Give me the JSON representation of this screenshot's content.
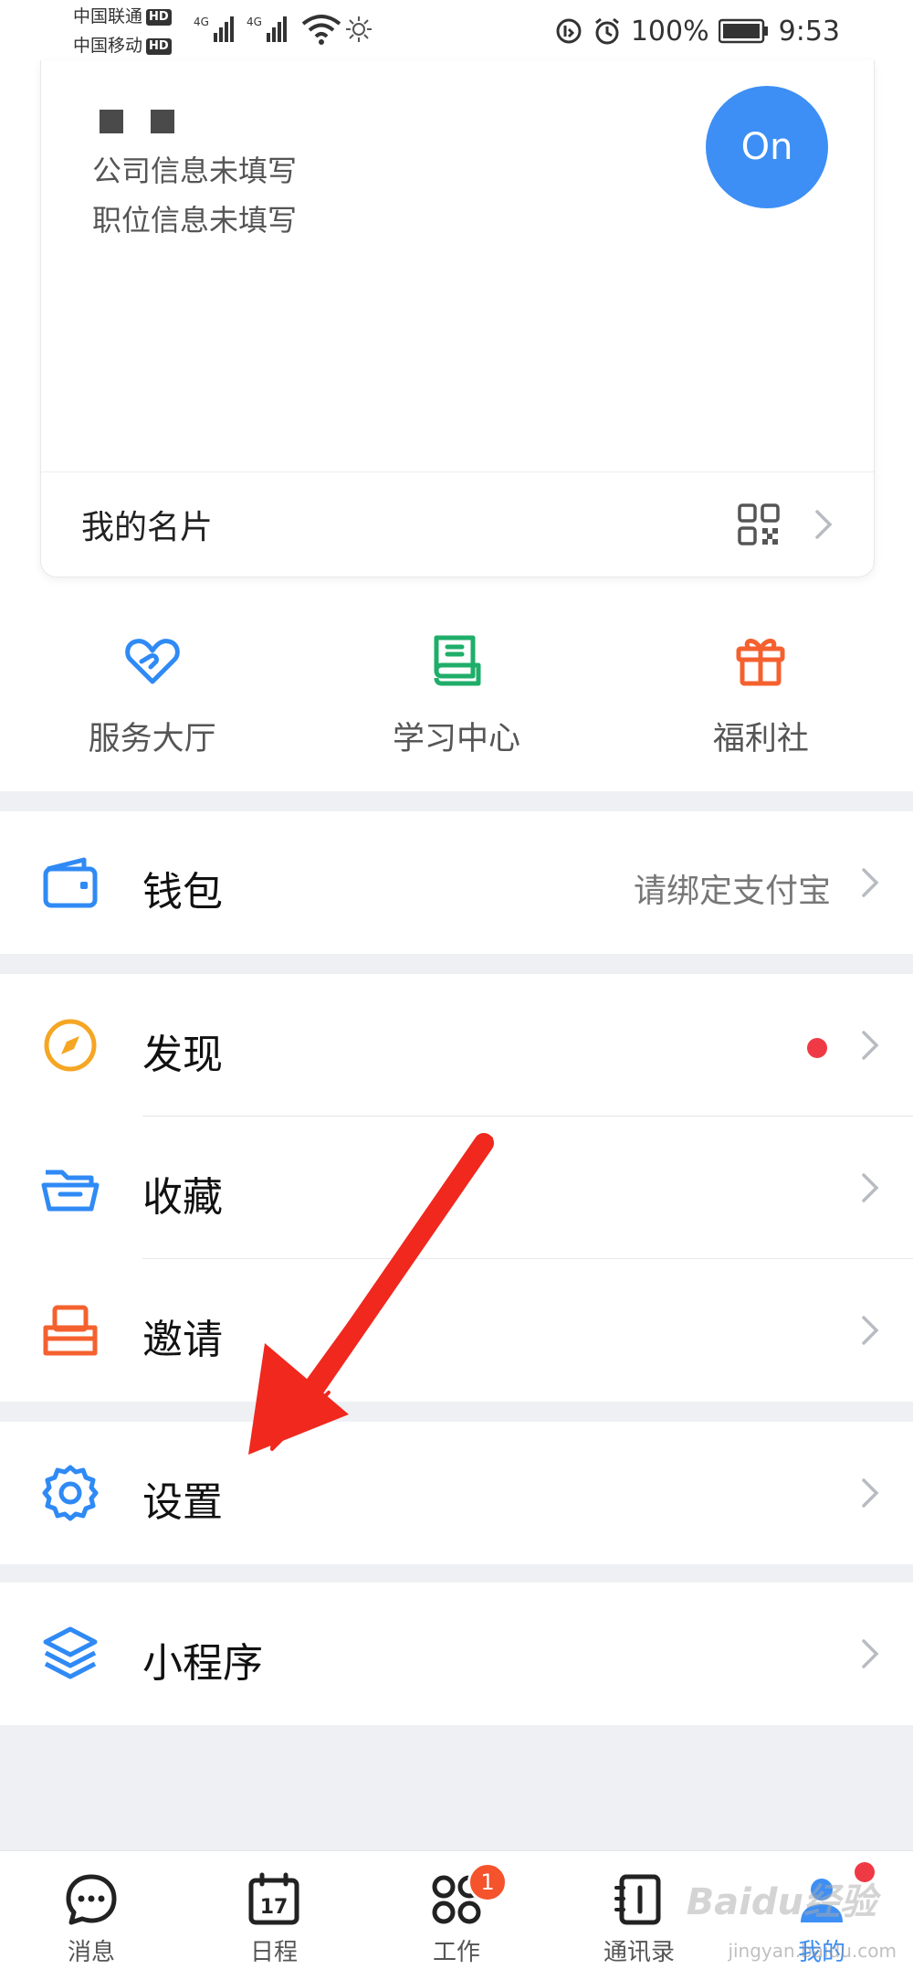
{
  "status_bar": {
    "carrier_1": "中国联通",
    "carrier_2": "中国移动",
    "hd": "HD",
    "network": "4G",
    "battery": "100%",
    "time": "9:53"
  },
  "profile": {
    "company": "公司信息未填写",
    "position": "职位信息未填写",
    "status_badge": "On",
    "card_label": "我的名片"
  },
  "quick_entries": [
    {
      "label": "服务大厅",
      "icon": "heart-hand-icon",
      "color": "#2f8af5"
    },
    {
      "label": "学习中心",
      "icon": "book-icon",
      "color": "#1fae6a"
    },
    {
      "label": "福利社",
      "icon": "gift-icon",
      "color": "#f4612f"
    }
  ],
  "menu": {
    "wallet": {
      "label": "钱包",
      "value": "请绑定支付宝"
    },
    "discover": {
      "label": "发现"
    },
    "favorites": {
      "label": "收藏"
    },
    "invite": {
      "label": "邀请"
    },
    "settings": {
      "label": "设置"
    },
    "mini_programs": {
      "label": "小程序"
    }
  },
  "tab_bar": {
    "tabs": [
      {
        "label": "消息",
        "icon": "chat-icon"
      },
      {
        "label": "日程",
        "icon": "calendar-icon",
        "day": "17"
      },
      {
        "label": "工作",
        "icon": "apps-icon",
        "badge": "1"
      },
      {
        "label": "通讯录",
        "icon": "contacts-icon"
      },
      {
        "label": "我的",
        "icon": "profile-icon"
      }
    ]
  },
  "watermark": {
    "brand": "Baidu经验",
    "domain": "jingyan.baidu.com"
  },
  "colors": {
    "accent": "#3d8ff5",
    "warning": "#f5a623",
    "danger": "#ef3a45",
    "orange": "#f4612f"
  }
}
